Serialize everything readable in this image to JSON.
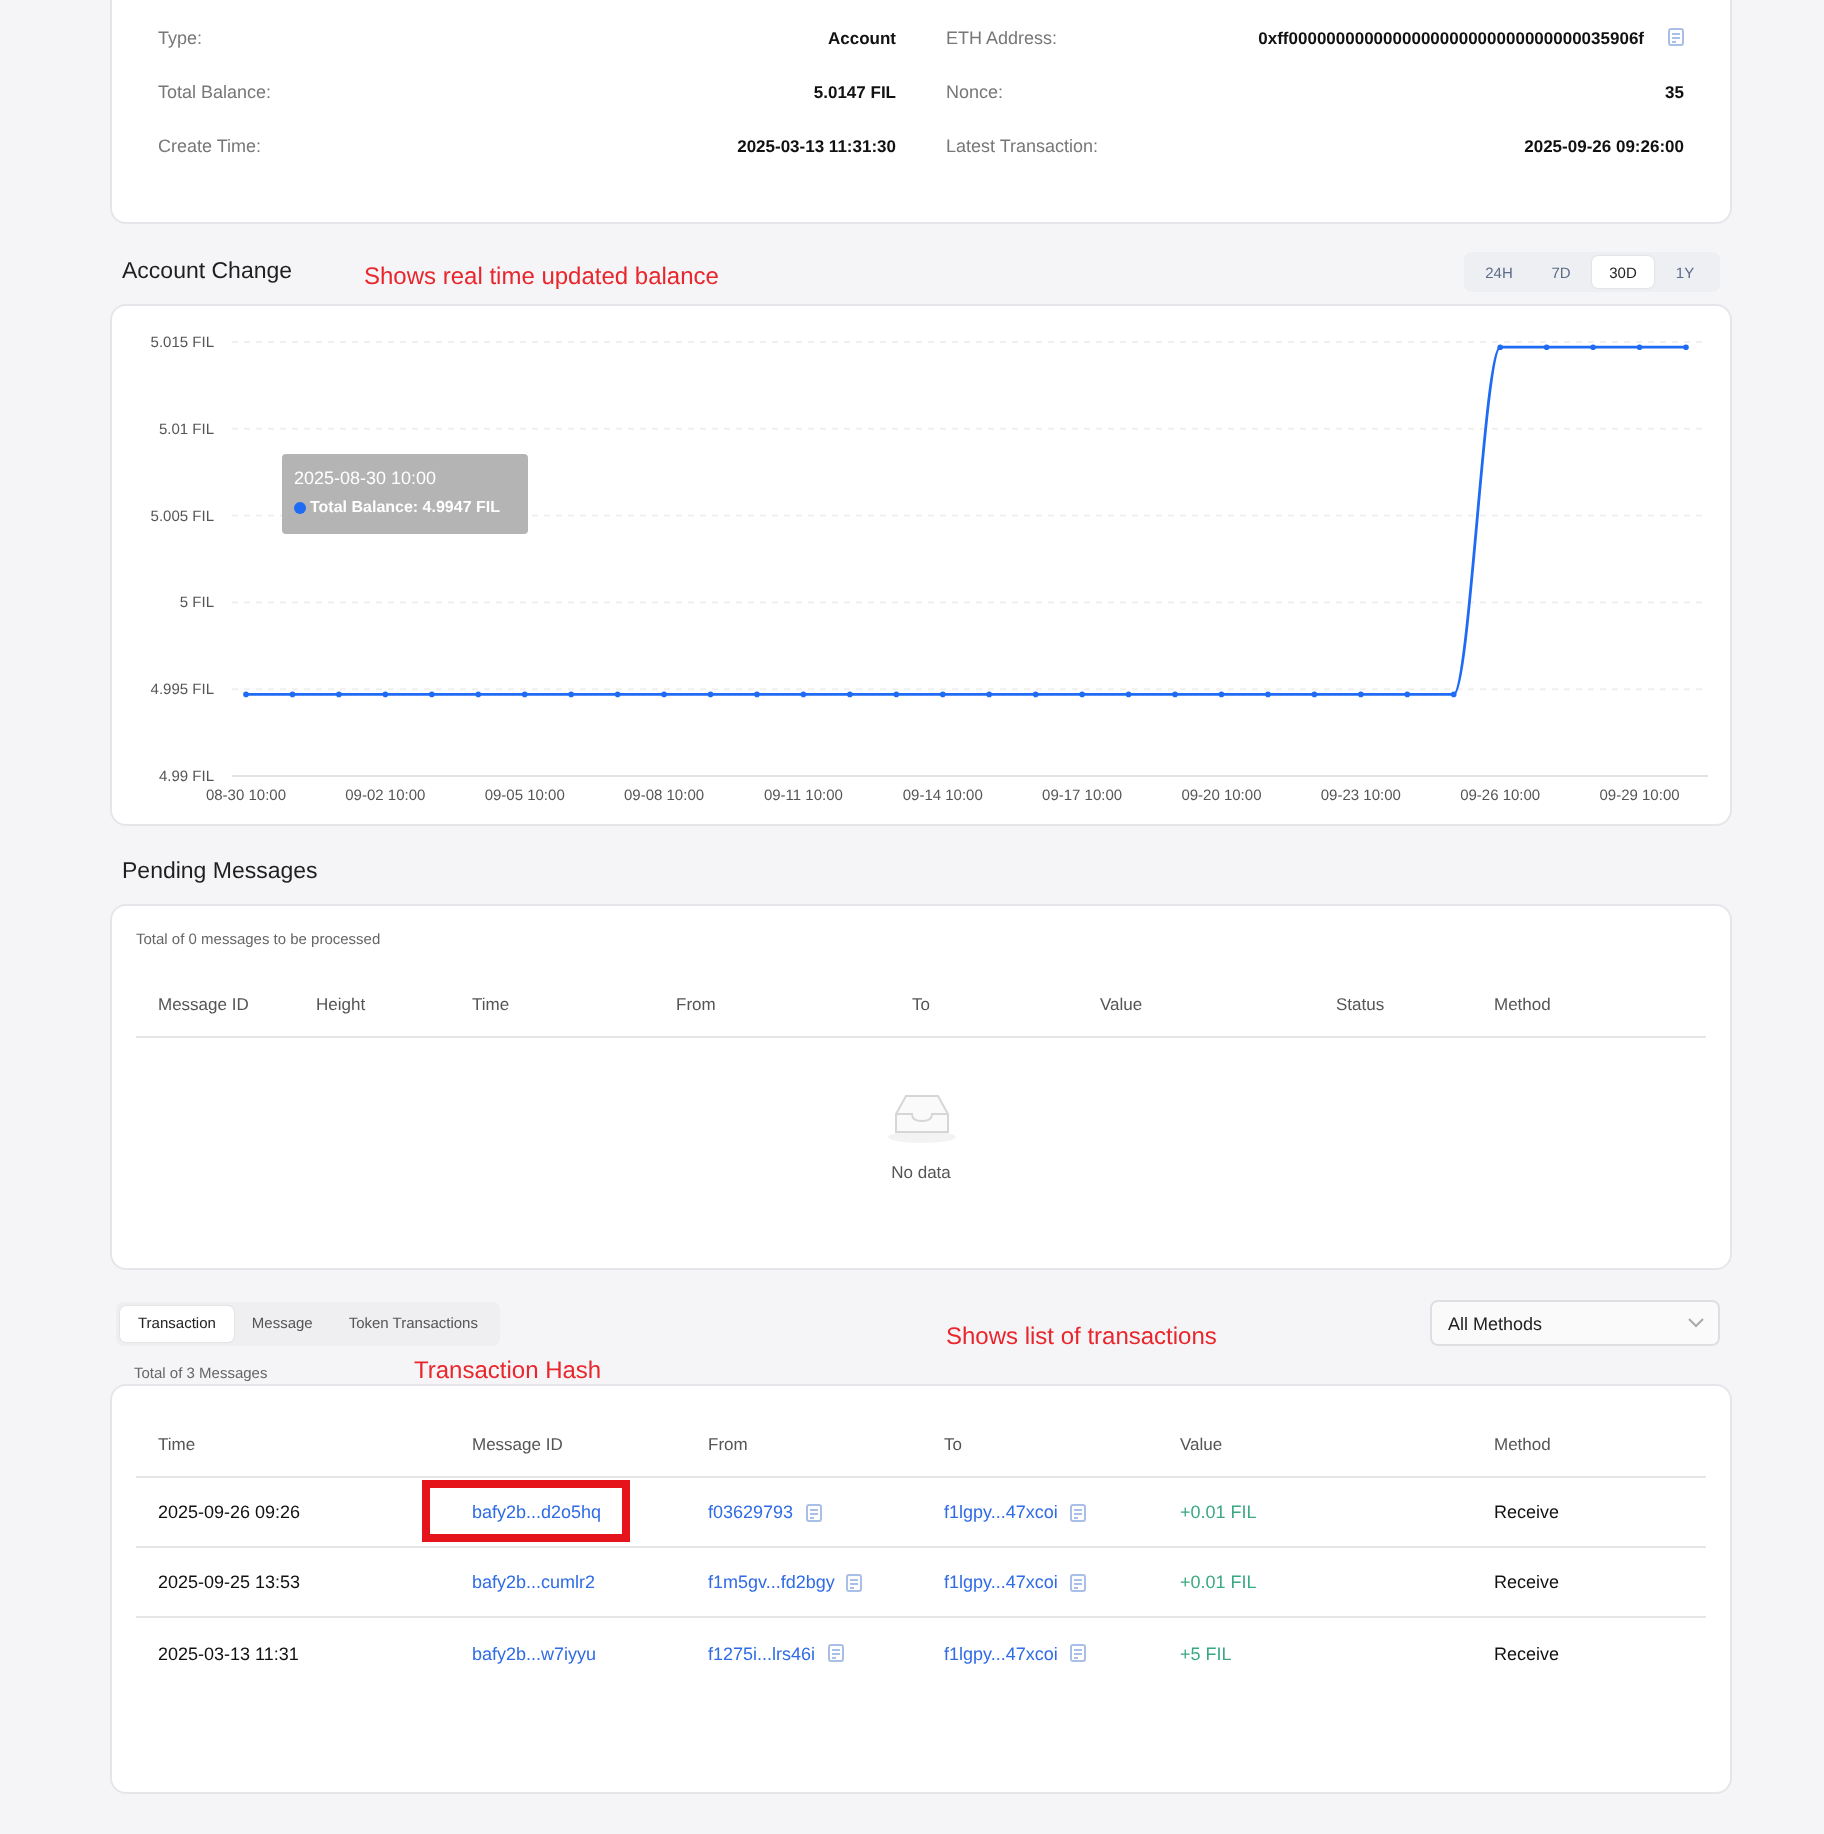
{
  "overview": {
    "fields": [
      {
        "label": "Type:",
        "value": "Account",
        "copyable": false
      },
      {
        "label": "ETH Address:",
        "value": "0xff0000000000000000000000000000000035906f",
        "copyable": true
      },
      {
        "label": "Total Balance:",
        "value": "5.0147 FIL",
        "copyable": false
      },
      {
        "label": "Nonce:",
        "value": "35",
        "copyable": false
      },
      {
        "label": "Create Time:",
        "value": "2025-03-13 11:31:30",
        "copyable": false
      },
      {
        "label": "Latest Transaction:",
        "value": "2025-09-26 09:26:00",
        "copyable": false
      }
    ]
  },
  "account_change": {
    "title": "Account Change",
    "annotation": "Shows real time updated balance",
    "periods": [
      {
        "label": "24H",
        "selected": false
      },
      {
        "label": "7D",
        "selected": false
      },
      {
        "label": "30D",
        "selected": true
      },
      {
        "label": "1Y",
        "selected": false
      }
    ],
    "chart_data": {
      "type": "line",
      "categories": [
        "08-30 10:00",
        null,
        null,
        "09-02 10:00",
        null,
        null,
        "09-05 10:00",
        null,
        null,
        "09-08 10:00",
        null,
        null,
        "09-11 10:00",
        null,
        null,
        "09-14 10:00",
        null,
        null,
        "09-17 10:00",
        null,
        null,
        "09-20 10:00",
        null,
        null,
        "09-23 10:00",
        null,
        null,
        "09-26 10:00",
        null,
        null,
        "09-29 10:00",
        null
      ],
      "series": [
        {
          "color": "#1f6bf5",
          "values": [
            4.9947,
            4.9947,
            4.9947,
            4.9947,
            4.9947,
            4.9947,
            4.9947,
            4.9947,
            4.9947,
            4.9947,
            4.9947,
            4.9947,
            4.9947,
            4.9947,
            4.9947,
            4.9947,
            4.9947,
            4.9947,
            4.9947,
            4.9947,
            4.9947,
            4.9947,
            4.9947,
            4.9947,
            4.9947,
            4.9947,
            4.9947,
            5.0147,
            5.0147,
            5.0147,
            5.0147,
            5.0147
          ]
        }
      ],
      "ylim": [
        4.99,
        5.015
      ],
      "yticks": [
        {
          "value": 4.99,
          "label": "4.99 FIL"
        },
        {
          "value": 4.995,
          "label": "4.995 FIL"
        },
        {
          "value": 5,
          "label": "5 FIL"
        },
        {
          "value": 5.005,
          "label": "5.005 FIL"
        },
        {
          "value": 5.01,
          "label": "5.01 FIL"
        },
        {
          "value": 5.015,
          "label": "5.015 FIL"
        }
      ],
      "grid": true
    },
    "tooltip": {
      "date": "2025-08-30 10:00",
      "text": "Total Balance: 4.9947 FIL"
    }
  },
  "pending_messages": {
    "title": "Pending Messages",
    "summary": "Total of 0 messages to be processed",
    "columns": [
      "Message ID",
      "Height",
      "Time",
      "From",
      "To",
      "Value",
      "Status",
      "Method"
    ],
    "empty_text": "No data"
  },
  "transactions": {
    "tabs": [
      {
        "label": "Transaction",
        "selected": true
      },
      {
        "label": "Message",
        "selected": false
      },
      {
        "label": "Token Transactions",
        "selected": false
      }
    ],
    "annotation": "Shows list of transactions",
    "filter": {
      "value": "All Methods"
    },
    "summary": "Total of 3 Messages",
    "hash_annotation": "Transaction Hash",
    "columns": [
      "Time",
      "Message ID",
      "From",
      "To",
      "Value",
      "Method"
    ],
    "rows": [
      {
        "time": "2025-09-26 09:26",
        "message_id": "bafy2b...d2o5hq",
        "from": "f03629793",
        "to": "f1lgpy...47xcoi",
        "value": "+0.01 FIL",
        "method": "Receive",
        "highlighted": true
      },
      {
        "time": "2025-09-25 13:53",
        "message_id": "bafy2b...cumlr2",
        "from": "f1m5gv...fd2bgy",
        "to": "f1lgpy...47xcoi",
        "value": "+0.01 FIL",
        "method": "Receive",
        "highlighted": false
      },
      {
        "time": "2025-03-13 11:31",
        "message_id": "bafy2b...w7iyyu",
        "from": "f1275i...lrs46i",
        "to": "f1lgpy...47xcoi",
        "value": "+5 FIL",
        "method": "Receive",
        "highlighted": false
      }
    ]
  }
}
